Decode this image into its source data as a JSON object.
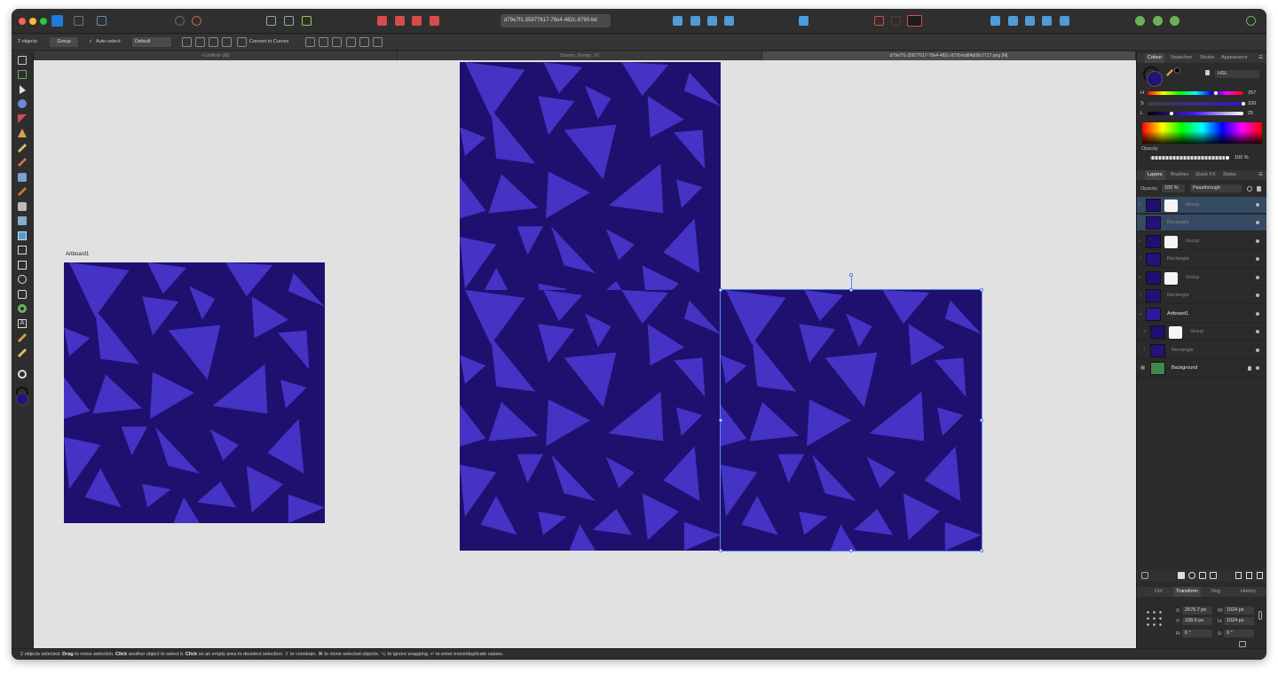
{
  "titlebar": {
    "document_name": "d79e7f1-35877617-78e4-482c-8790-bd"
  },
  "context_toolbar": {
    "selection_count": "2 objects",
    "group_label": "Group",
    "auto_select_label": "Auto-select:",
    "auto_select_value": "Default",
    "convert_label": "Convert to Curves"
  },
  "tabs": [
    {
      "label": "<Untitled> [M]"
    },
    {
      "label": "Stamps_Design_V3"
    },
    {
      "label": "d79e7f1-35877617-78e4-482c-8790-bd84d08c7717.png [M]"
    }
  ],
  "canvas": {
    "artboard_label": "Artboard1",
    "background_color": "#e1e1e1",
    "pattern_bg": "#1f1070",
    "triangle_color": "#4433c4"
  },
  "colour_panel": {
    "tabs": [
      "Colour",
      "Swatches",
      "Stroke",
      "Appearance"
    ],
    "model": "HSL",
    "h_label": "H",
    "h_value": "257",
    "s_label": "S",
    "s_value": "100",
    "l_label": "L",
    "l_value": "25",
    "h_level": 0.714,
    "s_level": 1.0,
    "l_level": 0.25,
    "opacity_label": "Opacity",
    "opacity_value": "100 %",
    "fill_color": "#23127a"
  },
  "layers_panel": {
    "tabs": [
      "Layers",
      "Brushes",
      "Quick FX",
      "Styles"
    ],
    "opacity_label": "Opacity:",
    "opacity_value": "100 %",
    "blend_mode": "Passthrough",
    "rows": [
      {
        "name": "Group",
        "kind": "group",
        "indent": 0,
        "selected": true
      },
      {
        "name": "Rectangle",
        "kind": "rect",
        "indent": 0,
        "selected": true
      },
      {
        "name": "Group",
        "kind": "group",
        "indent": 0,
        "selected": false
      },
      {
        "name": "Rectangle",
        "kind": "rect",
        "indent": 0,
        "selected": false
      },
      {
        "name": "Group",
        "kind": "group",
        "indent": 0,
        "selected": false
      },
      {
        "name": "Rectangle",
        "kind": "rect",
        "indent": 0,
        "selected": false
      },
      {
        "name": "Artboard1",
        "kind": "artboard",
        "indent": 0,
        "selected": false
      },
      {
        "name": "Group",
        "kind": "group",
        "indent": 1,
        "selected": false
      },
      {
        "name": "Rectangle",
        "kind": "rect",
        "indent": 1,
        "selected": false
      },
      {
        "name": "Background",
        "kind": "background",
        "indent": 0,
        "selected": false
      }
    ]
  },
  "transform_panel": {
    "tabs": [
      "Ctrl",
      "Transform",
      "Nvg",
      "History"
    ],
    "x_label": "X:",
    "x_value": "2576.7 px",
    "y_label": "Y:",
    "y_value": "108.6 px",
    "w_label": "W:",
    "w_value": "1024 px",
    "h_label": "H:",
    "h_value": "1024 px",
    "r_label": "R:",
    "r_value": "0 °",
    "s_label": "S:",
    "s_value": "0 °"
  },
  "status": {
    "t1": "2 objects selected. ",
    "b1": "Drag",
    "t2": " to move selection. ",
    "b2": "Click",
    "t3": " another object to select it. ",
    "b3": "Click",
    "t4": " on an empty area to deselect selection. ⇧ to constrain. ⌘ to clone selected objects. ⌥ to ignore snapping. ↵ to enter move/duplicate values."
  }
}
